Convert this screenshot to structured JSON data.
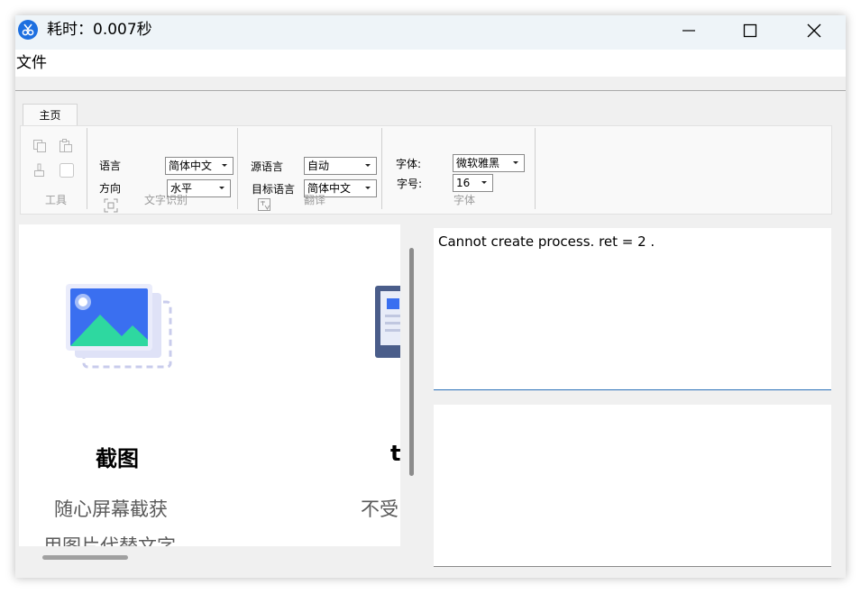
{
  "window": {
    "title": "耗时：0.007秒",
    "controls": {
      "minimize": "minimize-icon",
      "maximize": "maximize-icon",
      "close": "close-icon"
    }
  },
  "menu": {
    "items": [
      "文件"
    ]
  },
  "ribbon": {
    "tab": "主页",
    "groups": {
      "tools": {
        "label": "工具",
        "icons": [
          "copy-icon",
          "paste-icon",
          "clear-icon",
          "checkbox-icon"
        ]
      },
      "ocr": {
        "label": "文字识别",
        "language_label": "语言",
        "language_value": "简体中文",
        "direction_label": "方向",
        "direction_value": "水平",
        "icon": "ocr-icon"
      },
      "translate": {
        "label": "翻译",
        "source_label": "源语言",
        "source_value": "自动",
        "target_label": "目标语言",
        "target_value": "简体中文",
        "icon": "translate-icon"
      },
      "font": {
        "label": "字体",
        "family_label": "字体:",
        "family_value": "微软雅黑",
        "size_label": "字号:",
        "size_value": "16"
      }
    }
  },
  "features": [
    {
      "title": "截图",
      "desc_line1": "随心屏幕截获",
      "desc_line2": "用图片代替文字"
    },
    {
      "title": "t",
      "desc_line1": "不受",
      "desc_line2": ""
    }
  ],
  "output": {
    "text1": "Cannot create process. ret = 2 .",
    "text2": ""
  },
  "colors": {
    "accent": "#1d6fe0",
    "titlebar": "#eef4f8",
    "ribbon": "#f9f9f9"
  }
}
